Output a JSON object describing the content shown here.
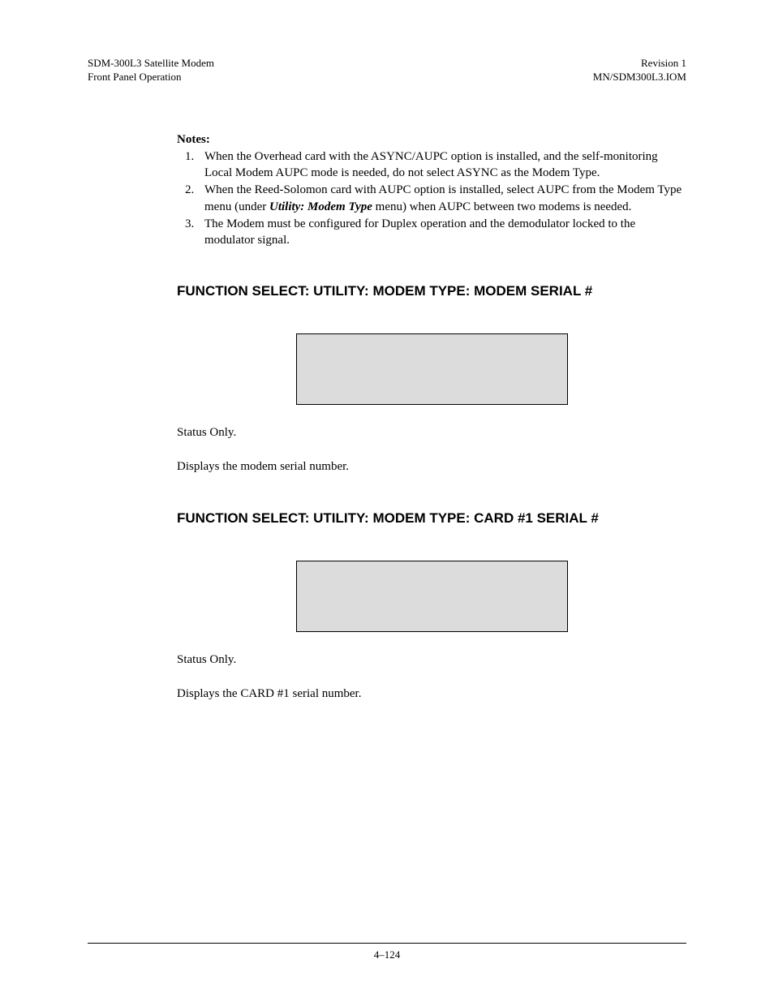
{
  "header": {
    "left_line1": "SDM-300L3 Satellite Modem",
    "left_line2": "Front Panel Operation",
    "right_line1": "Revision 1",
    "right_line2": "MN/SDM300L3.IOM"
  },
  "notes": {
    "heading": "Notes:",
    "items": [
      {
        "num": "1.",
        "text_before": "When the Overhead card with the ASYNC/AUPC option is installed, and the self-monitoring Local Modem AUPC mode is needed, do not select ASYNC as the Modem Type.",
        "emphasis": "",
        "text_after": ""
      },
      {
        "num": "2.",
        "text_before": "When the Reed-Solomon card with AUPC option is installed, select AUPC from the Modem Type menu (under ",
        "emphasis": "Utility: Modem Type",
        "text_after": " menu) when AUPC between two modems is needed."
      },
      {
        "num": "3.",
        "text_before": "The Modem must be configured for Duplex operation and the demodulator locked to the modulator signal.",
        "emphasis": "",
        "text_after": ""
      }
    ]
  },
  "sections": [
    {
      "heading": "FUNCTION SELECT: UTILITY: MODEM TYPE: MODEM SERIAL #",
      "status": "Status Only.",
      "description": "Displays the modem serial number."
    },
    {
      "heading": "FUNCTION SELECT: UTILITY: MODEM TYPE: CARD #1 SERIAL  #",
      "status": "Status Only.",
      "description": "Displays the CARD #1 serial number."
    }
  ],
  "footer": {
    "page": "4–124"
  }
}
